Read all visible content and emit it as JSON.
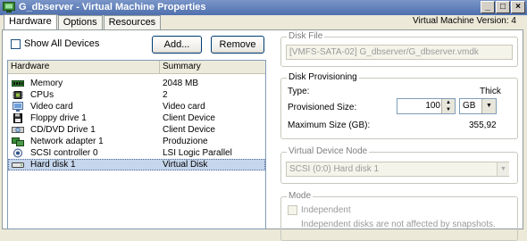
{
  "window": {
    "title": "G_dbserver - Virtual Machine Properties",
    "version": "Virtual Machine Version: 4",
    "controls": [
      "_",
      "□",
      "×"
    ]
  },
  "tabs": [
    {
      "label": "Hardware",
      "active": true
    },
    {
      "label": "Options",
      "active": false
    },
    {
      "label": "Resources",
      "active": false
    }
  ],
  "toolbar": {
    "show_all_devices": "Show All Devices",
    "show_all_checked": false,
    "add_label": "Add...",
    "remove_label": "Remove"
  },
  "hardware_table": {
    "headers": [
      "Hardware",
      "Summary"
    ],
    "rows": [
      {
        "icon": "memory-icon",
        "hardware": "Memory",
        "summary": "2048 MB"
      },
      {
        "icon": "cpu-icon",
        "hardware": "CPUs",
        "summary": "2"
      },
      {
        "icon": "video-card-icon",
        "hardware": "Video card",
        "summary": "Video card"
      },
      {
        "icon": "floppy-icon",
        "hardware": "Floppy drive 1",
        "summary": "Client Device"
      },
      {
        "icon": "cdrom-icon",
        "hardware": "CD/DVD Drive 1",
        "summary": "Client Device"
      },
      {
        "icon": "network-adapter-icon",
        "hardware": "Network adapter 1",
        "summary": "Produzione"
      },
      {
        "icon": "scsi-controller-icon",
        "hardware": "SCSI controller 0",
        "summary": "LSI Logic Parallel"
      },
      {
        "icon": "hard-disk-icon",
        "hardware": "Hard disk 1",
        "summary": "Virtual Disk",
        "selected": true
      }
    ]
  },
  "disk_file": {
    "label": "Disk File",
    "value": "[VMFS-SATA-02] G_dbserver/G_dbserver.vmdk"
  },
  "disk_provisioning": {
    "label": "Disk Provisioning",
    "type_label": "Type:",
    "type_value": "Thick",
    "provisioned_label": "Provisioned Size:",
    "provisioned_value": "100",
    "unit": "GB",
    "max_label": "Maximum Size (GB):",
    "max_value": "355,92"
  },
  "virtual_device_node": {
    "label": "Virtual Device Node",
    "value": "SCSI (0:0) Hard disk 1"
  },
  "mode": {
    "label": "Mode",
    "independent_label": "Independent",
    "independent_desc": "Independent disks are not affected by snapshots."
  },
  "colors": {
    "titlebar": "#5e7cb8",
    "selection": "#c6d6ec",
    "window_bg": "#ece9d8"
  }
}
